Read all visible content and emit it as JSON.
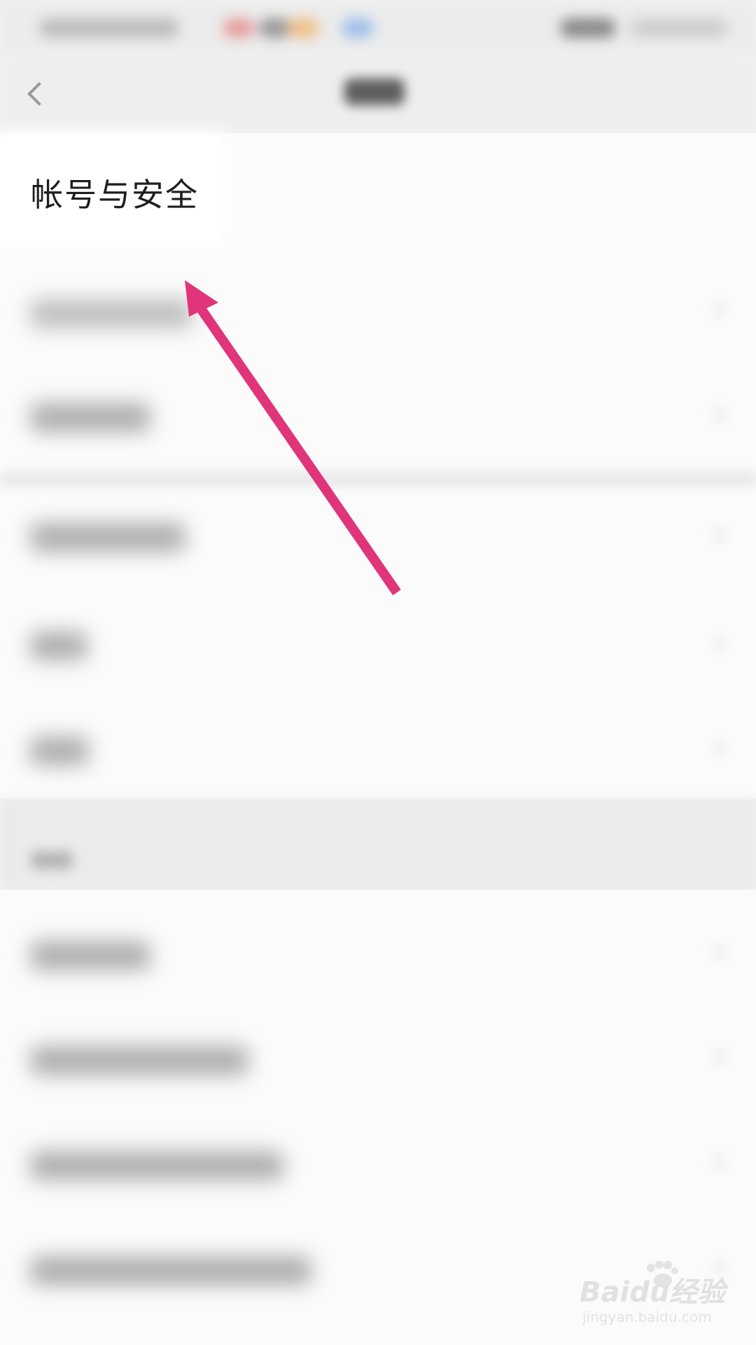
{
  "settings_list": {
    "highlighted_item_label": "帐号与安全"
  },
  "annotation": {
    "arrow_color": "#e0357a"
  },
  "watermark": {
    "brand": "Baidu经验",
    "url": "jingyan.baidu.com"
  }
}
